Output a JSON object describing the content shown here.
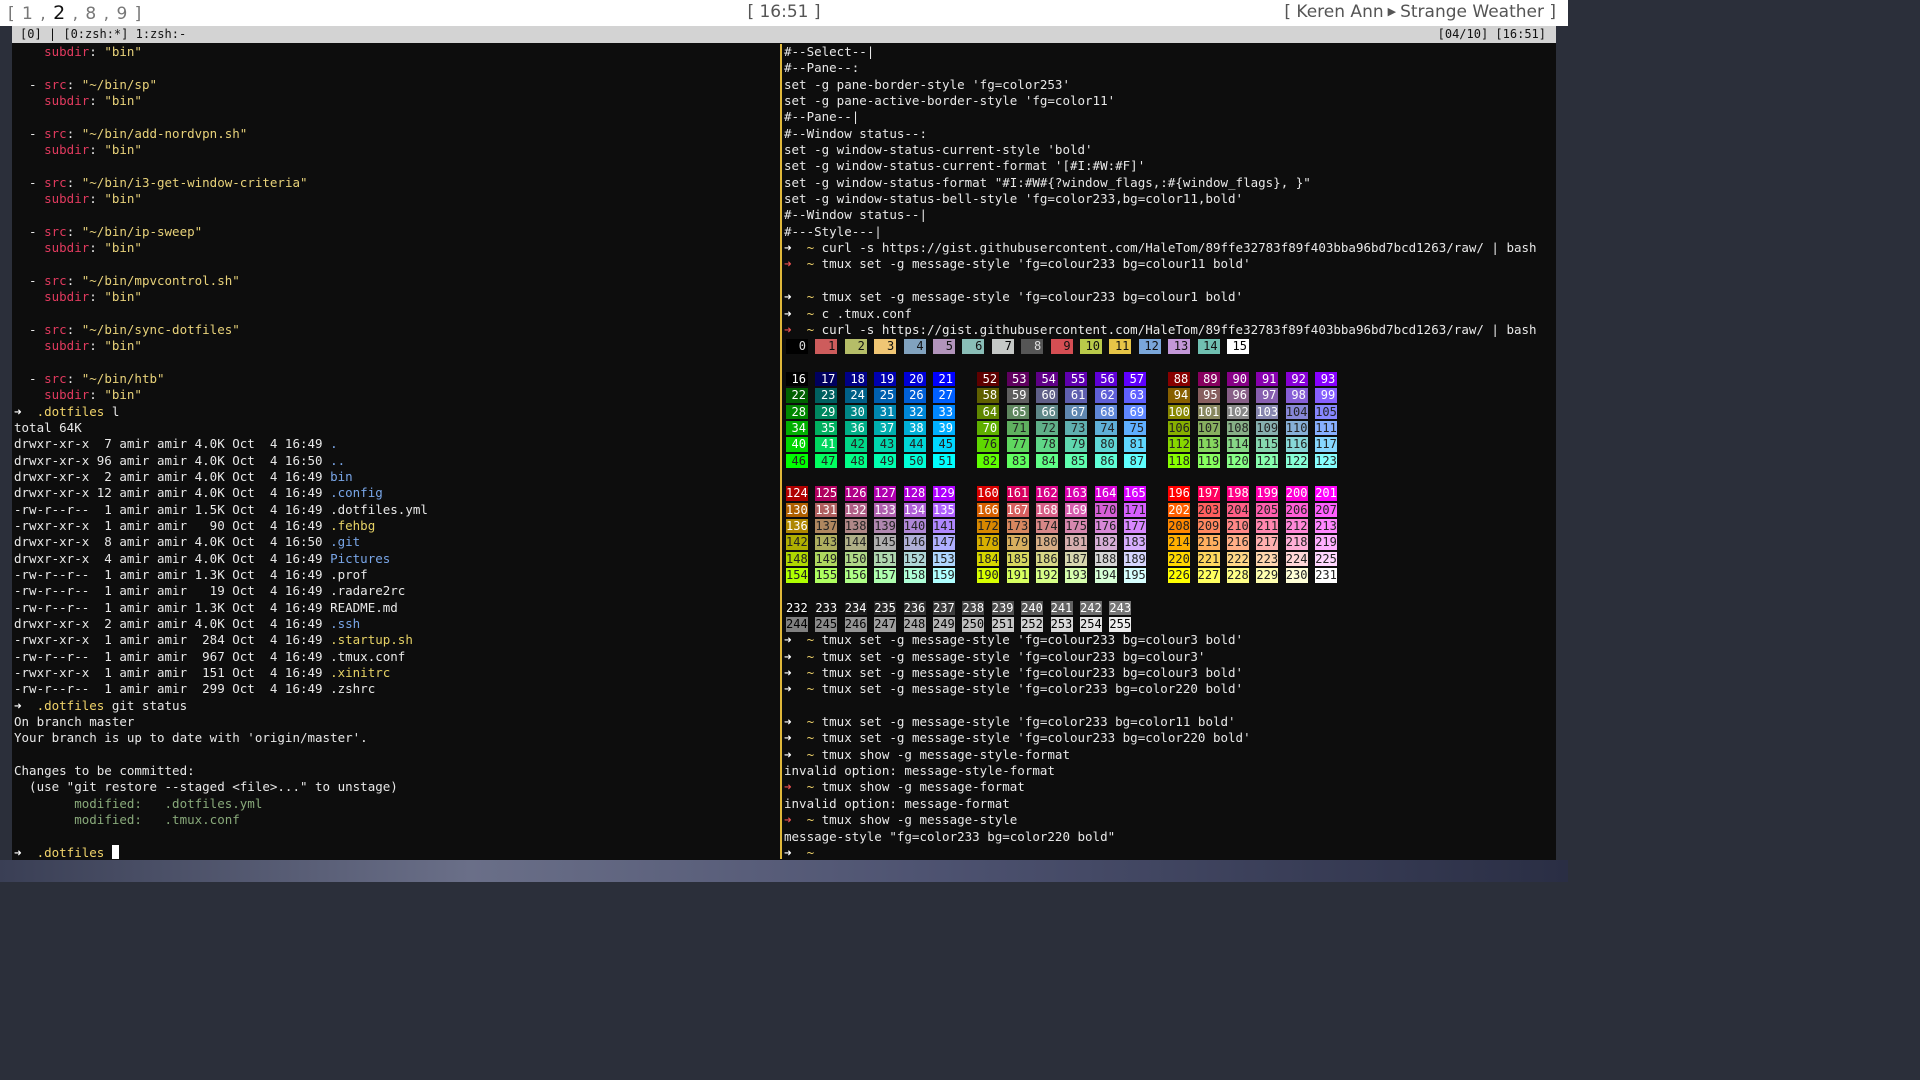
{
  "topbar": {
    "workspaces": [
      "1",
      "2",
      "8",
      "9"
    ],
    "current_workspace": "2",
    "clock": "[ 16:51 ]",
    "artist": "Keren Ann",
    "track": "Strange Weather ]"
  },
  "tmux": {
    "left": "[0] | [0:zsh:*] 1:zsh:-",
    "right": "[04/10] [16:51]"
  },
  "left_pane": {
    "lines": [
      [
        [
          "    ",
          ""
        ],
        [
          "subdir",
          "k"
        ],
        [
          ": ",
          ""
        ],
        [
          "\"bin\"",
          "s"
        ]
      ],
      [
        [
          "",
          ""
        ]
      ],
      [
        [
          "  - ",
          ""
        ],
        [
          "src",
          "k"
        ],
        [
          ": ",
          ""
        ],
        [
          "\"~/bin/sp\"",
          "s"
        ]
      ],
      [
        [
          "    ",
          ""
        ],
        [
          "subdir",
          "k"
        ],
        [
          ": ",
          ""
        ],
        [
          "\"bin\"",
          "s"
        ]
      ],
      [
        [
          "",
          ""
        ]
      ],
      [
        [
          "  - ",
          ""
        ],
        [
          "src",
          "k"
        ],
        [
          ": ",
          ""
        ],
        [
          "\"~/bin/add-nordvpn.sh\"",
          "s"
        ]
      ],
      [
        [
          "    ",
          ""
        ],
        [
          "subdir",
          "k"
        ],
        [
          ": ",
          ""
        ],
        [
          "\"bin\"",
          "s"
        ]
      ],
      [
        [
          "",
          ""
        ]
      ],
      [
        [
          "  - ",
          ""
        ],
        [
          "src",
          "k"
        ],
        [
          ": ",
          ""
        ],
        [
          "\"~/bin/i3-get-window-criteria\"",
          "s"
        ]
      ],
      [
        [
          "    ",
          ""
        ],
        [
          "subdir",
          "k"
        ],
        [
          ": ",
          ""
        ],
        [
          "\"bin\"",
          "s"
        ]
      ],
      [
        [
          "",
          ""
        ]
      ],
      [
        [
          "  - ",
          ""
        ],
        [
          "src",
          "k"
        ],
        [
          ": ",
          ""
        ],
        [
          "\"~/bin/ip-sweep\"",
          "s"
        ]
      ],
      [
        [
          "    ",
          ""
        ],
        [
          "subdir",
          "k"
        ],
        [
          ": ",
          ""
        ],
        [
          "\"bin\"",
          "s"
        ]
      ],
      [
        [
          "",
          ""
        ]
      ],
      [
        [
          "  - ",
          ""
        ],
        [
          "src",
          "k"
        ],
        [
          ": ",
          ""
        ],
        [
          "\"~/bin/mpvcontrol.sh\"",
          "s"
        ]
      ],
      [
        [
          "    ",
          ""
        ],
        [
          "subdir",
          "k"
        ],
        [
          ": ",
          ""
        ],
        [
          "\"bin\"",
          "s"
        ]
      ],
      [
        [
          "",
          ""
        ]
      ],
      [
        [
          "  - ",
          ""
        ],
        [
          "src",
          "k"
        ],
        [
          ": ",
          ""
        ],
        [
          "\"~/bin/sync-dotfiles\"",
          "s"
        ]
      ],
      [
        [
          "    ",
          ""
        ],
        [
          "subdir",
          "k"
        ],
        [
          ": ",
          ""
        ],
        [
          "\"bin\"",
          "s"
        ]
      ],
      [
        [
          "",
          ""
        ]
      ],
      [
        [
          "  - ",
          ""
        ],
        [
          "src",
          "k"
        ],
        [
          ": ",
          ""
        ],
        [
          "\"~/bin/htb\"",
          "s"
        ]
      ],
      [
        [
          "    ",
          ""
        ],
        [
          "subdir",
          "k"
        ],
        [
          ": ",
          ""
        ],
        [
          "\"bin\"",
          "s"
        ]
      ],
      [
        [
          "➜  ",
          "arrow"
        ],
        [
          ".dotfiles",
          "dir"
        ],
        [
          " l",
          ""
        ]
      ],
      [
        [
          "total 64K",
          ""
        ]
      ],
      [
        [
          "drwxr-xr-x  7 amir amir 4.0K Oct  4 16:49 ",
          ""
        ],
        [
          ".",
          "b"
        ]
      ],
      [
        [
          "drwxr-xr-x 96 amir amir 4.0K Oct  4 16:50 ",
          ""
        ],
        [
          "..",
          "b"
        ]
      ],
      [
        [
          "drwxr-xr-x  2 amir amir 4.0K Oct  4 16:49 ",
          ""
        ],
        [
          "bin",
          "b"
        ]
      ],
      [
        [
          "drwxr-xr-x 12 amir amir 4.0K Oct  4 16:49 ",
          ""
        ],
        [
          ".config",
          "b"
        ]
      ],
      [
        [
          "-rw-r--r--  1 amir amir 1.5K Oct  4 16:49 .dotfiles.yml",
          ""
        ]
      ],
      [
        [
          "-rwxr-xr-x  1 amir amir   90 Oct  4 16:49 ",
          ""
        ],
        [
          ".fehbg",
          "y"
        ]
      ],
      [
        [
          "drwxr-xr-x  8 amir amir 4.0K Oct  4 16:50 ",
          ""
        ],
        [
          ".git",
          "b"
        ]
      ],
      [
        [
          "drwxr-xr-x  4 amir amir 4.0K Oct  4 16:49 ",
          ""
        ],
        [
          "Pictures",
          "b"
        ]
      ],
      [
        [
          "-rw-r--r--  1 amir amir 1.3K Oct  4 16:49 .prof",
          ""
        ]
      ],
      [
        [
          "-rw-r--r--  1 amir amir   19 Oct  4 16:49 .radare2rc",
          ""
        ]
      ],
      [
        [
          "-rw-r--r--  1 amir amir 1.3K Oct  4 16:49 README.md",
          ""
        ]
      ],
      [
        [
          "drwxr-xr-x  2 amir amir 4.0K Oct  4 16:49 ",
          ""
        ],
        [
          ".ssh",
          "b"
        ]
      ],
      [
        [
          "-rwxr-xr-x  1 amir amir  284 Oct  4 16:49 ",
          ""
        ],
        [
          ".startup.sh",
          "y"
        ]
      ],
      [
        [
          "-rw-r--r--  1 amir amir  967 Oct  4 16:49 .tmux.conf",
          ""
        ]
      ],
      [
        [
          "-rwxr-xr-x  1 amir amir  151 Oct  4 16:49 ",
          ""
        ],
        [
          ".xinitrc",
          "y"
        ]
      ],
      [
        [
          "-rw-r--r--  1 amir amir  299 Oct  4 16:49 .zshrc",
          ""
        ]
      ],
      [
        [
          "➜  ",
          "arrow"
        ],
        [
          ".dotfiles",
          "dir"
        ],
        [
          " git status",
          ""
        ]
      ],
      [
        [
          "On branch master",
          ""
        ]
      ],
      [
        [
          "Your branch is up to date with 'origin/master'.",
          ""
        ]
      ],
      [
        [
          "",
          ""
        ]
      ],
      [
        [
          "Changes to be committed:",
          ""
        ]
      ],
      [
        [
          "  (use \"git restore --staged <file>...\" to unstage)",
          ""
        ]
      ],
      [
        [
          "        ",
          ""
        ],
        [
          "modified:   .dotfiles.yml",
          "gr"
        ]
      ],
      [
        [
          "        ",
          ""
        ],
        [
          "modified:   .tmux.conf",
          "gr"
        ]
      ],
      [
        [
          "",
          ""
        ]
      ],
      [
        [
          "➜  ",
          "arrow"
        ],
        [
          ".dotfiles",
          "dir"
        ],
        [
          " ",
          ""
        ],
        [
          "CURSOR",
          "cursor"
        ]
      ]
    ]
  },
  "right_pane": {
    "top_lines": [
      [
        [
          "#--Select--|",
          ""
        ]
      ],
      [
        [
          "#--Pane--:",
          ""
        ]
      ],
      [
        [
          "set -g pane-border-style 'fg=color253'",
          ""
        ]
      ],
      [
        [
          "set -g pane-active-border-style 'fg=color11'",
          ""
        ]
      ],
      [
        [
          "#--Pane--|",
          ""
        ]
      ],
      [
        [
          "#--Window status--:",
          ""
        ]
      ],
      [
        [
          "set -g window-status-current-style 'bold'",
          ""
        ]
      ],
      [
        [
          "set -g window-status-current-format '[#I:#W:#F]'",
          ""
        ]
      ],
      [
        [
          "set -g window-status-format \"#I:#W#{?window_flags,:#{window_flags}, }\"",
          ""
        ]
      ],
      [
        [
          "set -g window-status-bell-style 'fg=color233,bg=color11,bold'",
          ""
        ]
      ],
      [
        [
          "#--Window status--|",
          ""
        ]
      ],
      [
        [
          "#---Style---|",
          ""
        ]
      ],
      [
        [
          "➜  ",
          "arrow"
        ],
        [
          "~",
          "dir"
        ],
        [
          " curl -s https://gist.githubusercontent.com/HaleTom/89ffe32783f89f403bba96bd7bcd1263/raw/ | bash",
          ""
        ]
      ],
      [
        [
          "➜  ",
          "arrowr"
        ],
        [
          "~",
          "dir"
        ],
        [
          " tmux set -g message-style 'fg=colour233 bg=colour11 bold'",
          ""
        ]
      ],
      [
        [
          "",
          ""
        ]
      ],
      [
        [
          "➜  ",
          "arrow"
        ],
        [
          "~",
          "dir"
        ],
        [
          " tmux set -g message-style 'fg=colour233 bg=colour1 bold'",
          ""
        ]
      ],
      [
        [
          "➜  ",
          "arrow"
        ],
        [
          "~",
          "dir"
        ],
        [
          " c .tmux.conf",
          ""
        ]
      ],
      [
        [
          "➜  ",
          "arrowr"
        ],
        [
          "~",
          "dir"
        ],
        [
          " curl -s https://gist.githubusercontent.com/HaleTom/89ffe32783f89f403bba96bd7bcd1263/raw/ | bash",
          ""
        ]
      ]
    ],
    "bottom_lines": [
      [
        [
          "➜  ",
          "arrow"
        ],
        [
          "~",
          "dir"
        ],
        [
          " tmux set -g message-style 'fg=colour233 bg=colour3 bold'",
          ""
        ]
      ],
      [
        [
          "➜  ",
          "arrow"
        ],
        [
          "~",
          "dir"
        ],
        [
          " tmux set -g message-style 'fg=colour233 bg=colour3'",
          ""
        ]
      ],
      [
        [
          "➜  ",
          "arrow"
        ],
        [
          "~",
          "dir"
        ],
        [
          " tmux set -g message-style 'fg=colour233 bg=colour3 bold'",
          ""
        ]
      ],
      [
        [
          "➜  ",
          "arrow"
        ],
        [
          "~",
          "dir"
        ],
        [
          " tmux set -g message-style 'fg=color233 bg=color220 bold'",
          ""
        ]
      ],
      [
        [
          "",
          ""
        ]
      ],
      [
        [
          "➜  ",
          "arrow"
        ],
        [
          "~",
          "dir"
        ],
        [
          " tmux set -g message-style 'fg=color233 bg=color11 bold'",
          ""
        ]
      ],
      [
        [
          "➜  ",
          "arrow"
        ],
        [
          "~",
          "dir"
        ],
        [
          " tmux set -g message-style 'fg=colour233 bg=color220 bold'",
          ""
        ]
      ],
      [
        [
          "➜  ",
          "arrow"
        ],
        [
          "~",
          "dir"
        ],
        [
          " tmux show -g message-style-format",
          ""
        ]
      ],
      [
        [
          "invalid option: message-style-format",
          ""
        ]
      ],
      [
        [
          "➜  ",
          "arrowr"
        ],
        [
          "~",
          "dir"
        ],
        [
          " tmux show -g message-format",
          ""
        ]
      ],
      [
        [
          "invalid option: message-format",
          ""
        ]
      ],
      [
        [
          "➜  ",
          "arrowr"
        ],
        [
          "~",
          "dir"
        ],
        [
          " tmux show -g message-style",
          ""
        ]
      ],
      [
        [
          "message-style \"fg=color233 bg=color220 bold\"",
          ""
        ]
      ],
      [
        [
          "➜  ",
          "arrow"
        ],
        [
          "~",
          "dir"
        ],
        [
          " ",
          ""
        ]
      ]
    ]
  },
  "colors": {
    "tmux_bar_bg": "#d3d3d3",
    "active_border": "#e0b83a",
    "terminal_bg": "#0d0d0d"
  }
}
